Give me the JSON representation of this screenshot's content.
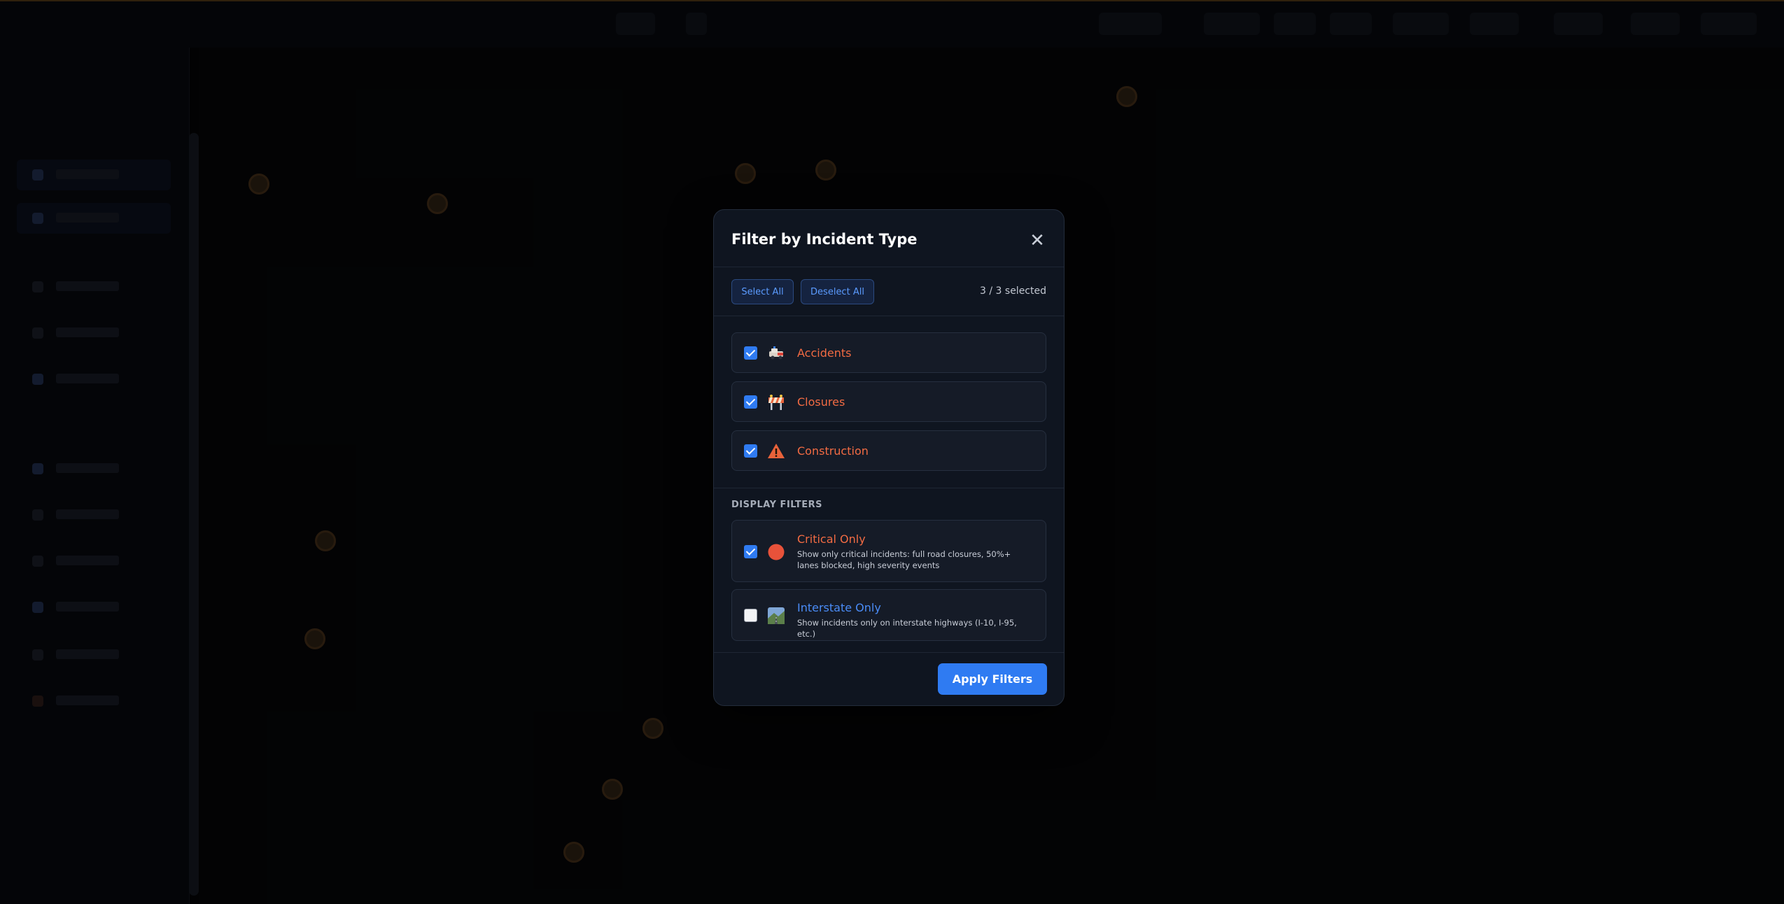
{
  "modal": {
    "title": "Filter by Incident Type",
    "select_all": "Select All",
    "deselect_all": "Deselect All",
    "selected_count": "3 / 3 selected",
    "incident_types": [
      {
        "label": "Accidents",
        "checked": true,
        "icon": "car-crash-icon"
      },
      {
        "label": "Closures",
        "checked": true,
        "icon": "barrier-icon"
      },
      {
        "label": "Construction",
        "checked": true,
        "icon": "warning-triangle-icon"
      }
    ],
    "display_section_label": "DISPLAY FILTERS",
    "display_filters": [
      {
        "title": "Critical Only",
        "description": "Show only critical incidents: full road closures, 50%+ lanes blocked, high severity events",
        "checked": true,
        "icon": "red-circle-icon"
      },
      {
        "title": "Interstate Only",
        "description": "Show incidents only on interstate highways (I-10, I-95, etc.)",
        "checked": false,
        "icon": "highway-icon"
      }
    ],
    "apply_label": "Apply Filters"
  },
  "colors": {
    "accent": "#2f7bf2",
    "incident_text": "#f26b43",
    "interstate_text": "#4a8cf7",
    "modal_bg": "#0f1520"
  }
}
